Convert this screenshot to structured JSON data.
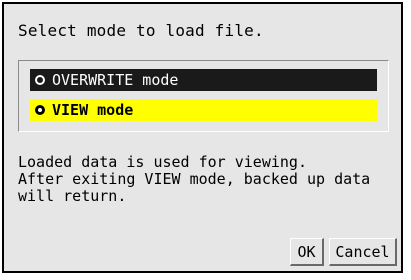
{
  "dialog": {
    "title": "Select mode to load file.",
    "options": [
      {
        "label": "OVERWRITE mode",
        "selected": false
      },
      {
        "label": "VIEW mode",
        "selected": true
      }
    ],
    "description": [
      "Loaded data is used for viewing.",
      "After exiting VIEW mode, backed up data",
      "will return."
    ],
    "buttons": {
      "ok": "OK",
      "cancel": "Cancel"
    }
  },
  "colors": {
    "highlight": "#ffff00",
    "option_dark": "#1a1a1a",
    "window_bg": "#e6e6e6"
  },
  "icons": {
    "radio_unselected": "radio-unselected-icon",
    "radio_selected": "radio-selected-icon"
  }
}
